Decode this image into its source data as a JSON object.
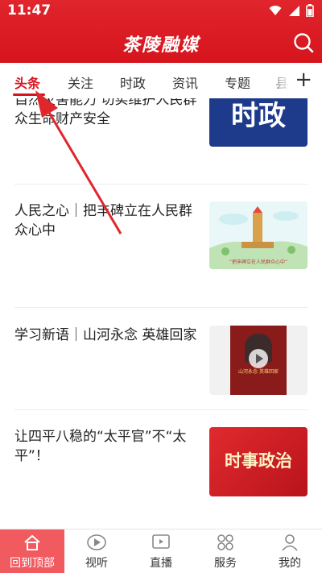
{
  "status_bar": {
    "time": "11:47"
  },
  "header": {
    "app_title": "茶陵融媒",
    "search_icon": "search-icon"
  },
  "tabs": [
    {
      "label": "头条",
      "active": true
    },
    {
      "label": "关注",
      "active": false
    },
    {
      "label": "时政",
      "active": false
    },
    {
      "label": "资讯",
      "active": false
    },
    {
      "label": "专题",
      "active": false
    },
    {
      "label": "县",
      "active": false
    }
  ],
  "tab_add_label": "+",
  "articles": [
    {
      "title": "自然灾害能力 切实维护人民群众生命财产安全",
      "thumb_text": "时政"
    },
    {
      "title": "人民之心｜把丰碑立在人民群众心中",
      "thumb_caption": "“把丰碑立在人民群众心中”"
    },
    {
      "title": "学习新语｜山河永念 英雄回家",
      "thumb_caption": "山河永念 英雄回家"
    },
    {
      "title": "让四平八稳的“太平官”不“太平”！",
      "thumb_text": "时事政治"
    }
  ],
  "bottom_nav": [
    {
      "label": "回到顶部",
      "icon": "home-icon",
      "active": true
    },
    {
      "label": "视听",
      "icon": "play-icon",
      "active": false
    },
    {
      "label": "直播",
      "icon": "live-icon",
      "active": false
    },
    {
      "label": "服务",
      "icon": "services-icon",
      "active": false
    },
    {
      "label": "我的",
      "icon": "profile-icon",
      "active": false
    }
  ],
  "colors": {
    "brand_red": "#d6141d",
    "active_nav_bg": "#f15a5f",
    "annotation_arrow": "#e0262d"
  }
}
